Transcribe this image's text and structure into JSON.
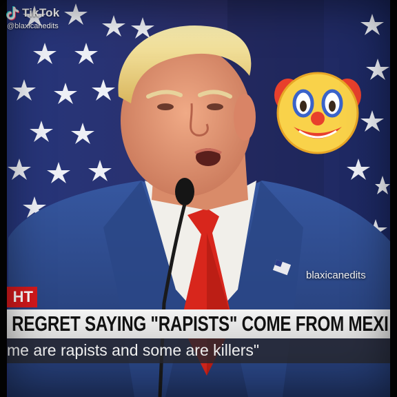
{
  "tiktok": {
    "brand": "TikTok",
    "handle": "@blaxicanedits"
  },
  "watermark": "blaxicanedits",
  "news": {
    "live_tag": "HT",
    "headline": "REGRET SAYING \"RAPISTS\" COME FROM MEXI",
    "ticker": "me are rapists and some are killers\""
  },
  "icons": {
    "logo": "tiktok-logo-icon",
    "emoji": "clown-face-emoji-icon"
  },
  "colors": {
    "live_red": "#d4191c",
    "tie_red": "#d8261c",
    "suit_blue": "#2c4a86",
    "flag_blue": "#1f2f73"
  }
}
